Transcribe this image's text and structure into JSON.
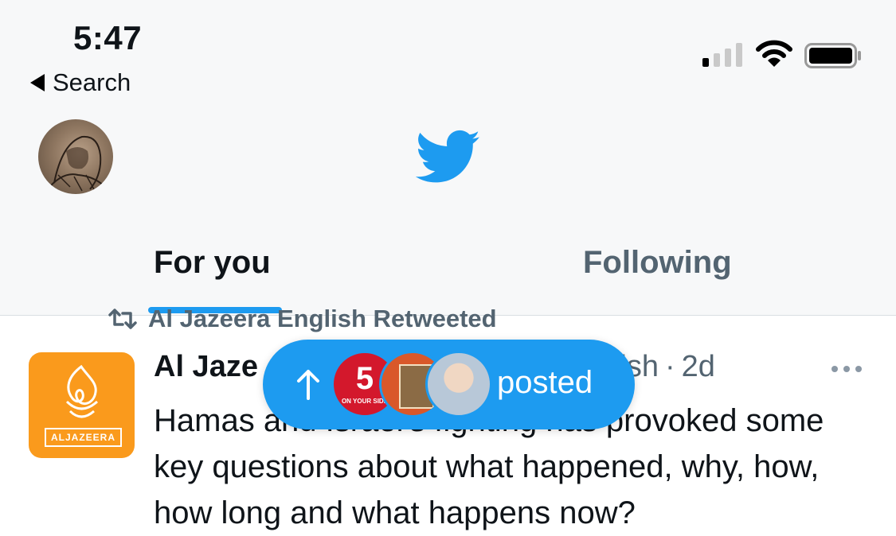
{
  "status_bar": {
    "time": "5:47",
    "back_label": "Search"
  },
  "tabs": [
    {
      "label": "For you",
      "selected": true
    },
    {
      "label": "Following",
      "selected": false
    }
  ],
  "tweet": {
    "retweet_label": "Al Jazeera English Retweeted",
    "author": "Al Jazeera English",
    "author_visible": "Al Jaze",
    "handle_fragment": "lish",
    "separator": "·",
    "time": "2d",
    "text": "Hamas and Israel's fighting has provoked some key questions about what happened, why, how, how long and what happens now?",
    "avatar_label": "ALJAZEERA"
  },
  "new_posts_pill": {
    "label": "posted",
    "avatars": [
      "channel-5-on-your-side-avatar",
      "book-cover-avatar",
      "man-portrait-avatar"
    ],
    "channel_number": "5",
    "channel_tagline": "ON YOUR SIDE"
  },
  "colors": {
    "accent": "#1d9bf0",
    "text_primary": "#0f1419",
    "text_secondary": "#536471",
    "brand_orange": "#fa9a1c"
  }
}
